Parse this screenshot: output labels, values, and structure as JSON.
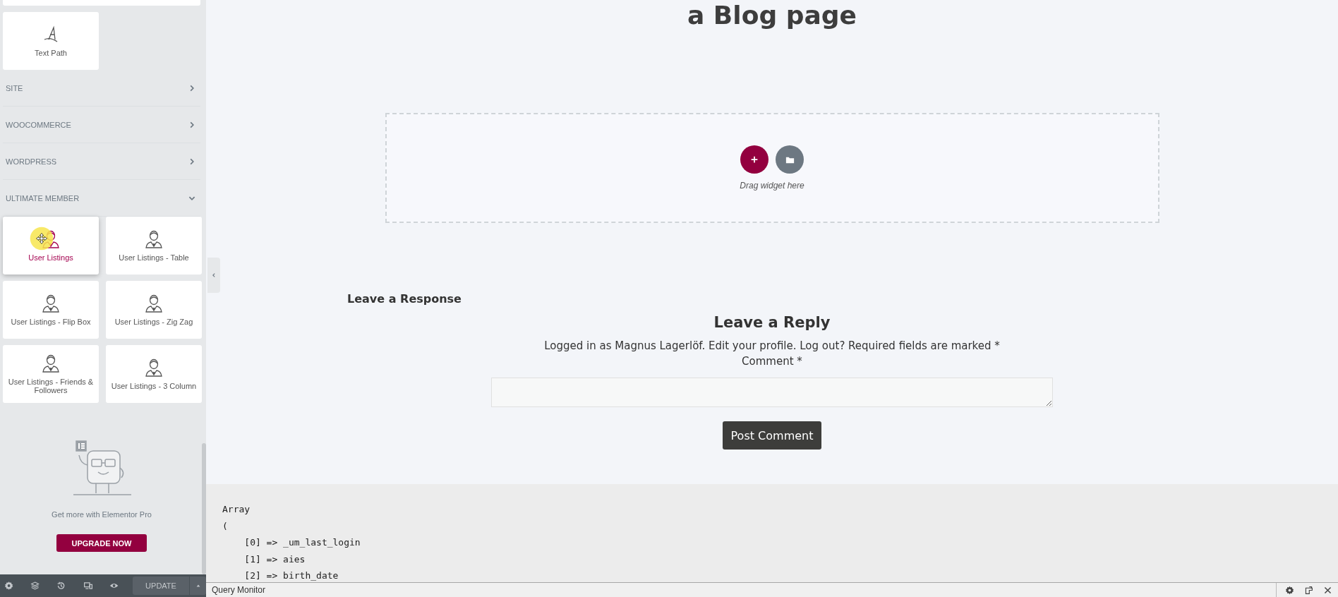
{
  "sidebar": {
    "top_widget": {
      "label": "Text Path"
    },
    "categories": [
      {
        "label": "SITE",
        "expanded": false
      },
      {
        "label": "WOOCOMMERCE",
        "expanded": false
      },
      {
        "label": "WORDPRESS",
        "expanded": false
      },
      {
        "label": "ULTIMATE MEMBER",
        "expanded": true
      }
    ],
    "widgets": [
      {
        "label": "User Listings",
        "selected": true
      },
      {
        "label": "User Listings - Table",
        "selected": false
      },
      {
        "label": "User Listings - Flip Box",
        "selected": false
      },
      {
        "label": "User Listings - Zig Zag",
        "selected": false
      },
      {
        "label": "User Listings - Friends & Followers",
        "selected": false
      },
      {
        "label": "User Listings - 3 Column",
        "selected": false
      }
    ],
    "promo": {
      "text": "Get more with Elementor Pro",
      "button": "UPGRADE NOW"
    },
    "footer": {
      "update_button": "UPDATE"
    }
  },
  "canvas": {
    "page_title": "a Blog page",
    "drop_zone": {
      "hint": "Drag widget here"
    },
    "response_heading": "Leave a Response",
    "reply_title": "Leave a Reply",
    "logged_in_text": "Logged in as Magnus Lagerlöf. Edit your profile. Log out? Required fields are marked *",
    "comment_label": "Comment *",
    "submit_button": "Post Comment",
    "code_lines": [
      "Array",
      "(",
      "    [0] => _um_last_login",
      "    [1] => aies",
      "    [2] => birth_date"
    ]
  },
  "query_monitor": {
    "title": "Query Monitor"
  }
}
